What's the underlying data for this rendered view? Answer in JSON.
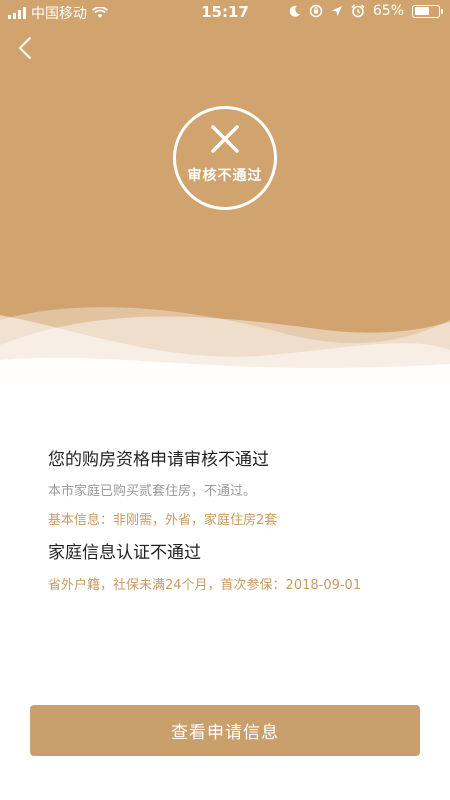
{
  "status_bar": {
    "carrier": "中国移动",
    "time": "15:17",
    "battery_text": "65%",
    "battery_level": 0.65,
    "icons": [
      "signal-icon",
      "wifi-icon",
      "moon-icon",
      "orientation-lock-icon",
      "location-icon",
      "alarm-icon",
      "battery-icon"
    ]
  },
  "header": {
    "back_icon": "chevron-left-icon",
    "result_icon": "close-icon",
    "result_label": "审核不通过"
  },
  "result": {
    "title": "您的购房资格申请审核不通过",
    "description": "本市家庭已购买贰套住房，不通过。",
    "basic_info": "基本信息：非刚需，外省，家庭住房2套",
    "family_title": "家庭信息认证不通过",
    "family_info": "省外户籍，社保未满24个月，首次参保：2018-09-01"
  },
  "actions": {
    "view_application_label": "查看申请信息"
  },
  "colors": {
    "accent": "#d1a36e",
    "button": "#c9a06c",
    "highlight_text": "#c99a62",
    "muted_text": "#999999"
  }
}
